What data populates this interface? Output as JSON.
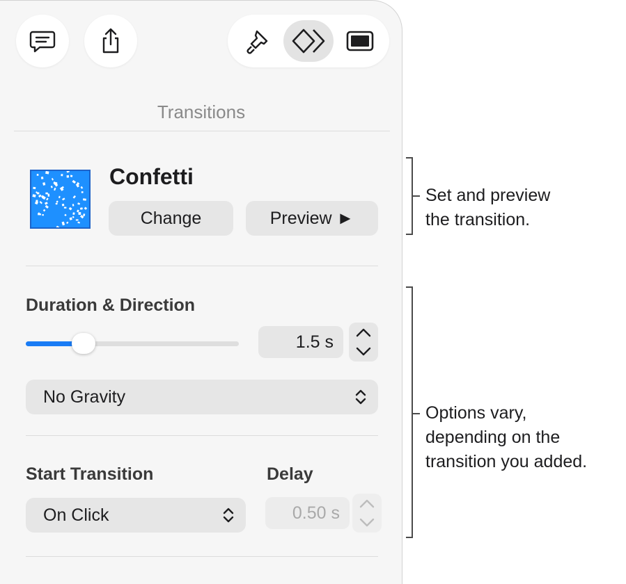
{
  "toolbar": {
    "buttons": [
      {
        "icon": "comment-icon"
      },
      {
        "icon": "share-icon"
      }
    ],
    "inspector_tabs": [
      {
        "icon": "paintbrush-icon",
        "active": false
      },
      {
        "icon": "transition-diamonds-icon",
        "active": true
      },
      {
        "icon": "slide-layout-icon",
        "active": false
      }
    ]
  },
  "panel": {
    "title": "Transitions",
    "transition": {
      "name": "Confetti",
      "change_label": "Change",
      "preview_label": "Preview ►"
    },
    "duration": {
      "label": "Duration & Direction",
      "value": "1.5 s",
      "slider_fraction": 0.27
    },
    "direction_popup": {
      "selected": "No Gravity"
    },
    "start": {
      "label": "Start Transition",
      "selected": "On Click"
    },
    "delay": {
      "label": "Delay",
      "value": "0.50 s",
      "enabled": false
    }
  },
  "callouts": {
    "top": [
      "Set and preview",
      "the transition."
    ],
    "bottom": [
      "Options vary,",
      "depending on the",
      "transition you added."
    ]
  },
  "colors": {
    "accent": "#1a7cf5",
    "thumbnail": "#1e90ff"
  }
}
